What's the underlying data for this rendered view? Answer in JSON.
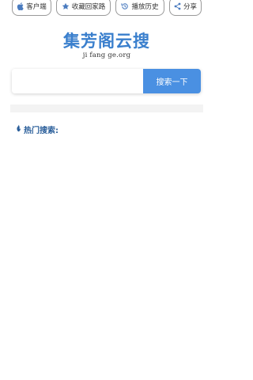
{
  "topbar": {
    "client_label": "客户端",
    "favorite_label": "收藏回家路",
    "history_label": "播放历史",
    "share_label": "分享"
  },
  "logo": {
    "title": "集芳阁云搜",
    "subtitle": "ji fang ge.org"
  },
  "search": {
    "placeholder": "",
    "value": "",
    "button_label": "搜索一下"
  },
  "hot_search": {
    "label": "热门搜索:"
  },
  "colors": {
    "accent": "#4a90e2",
    "logo": "#3a7fcd",
    "hot_label": "#2a5e9a"
  }
}
